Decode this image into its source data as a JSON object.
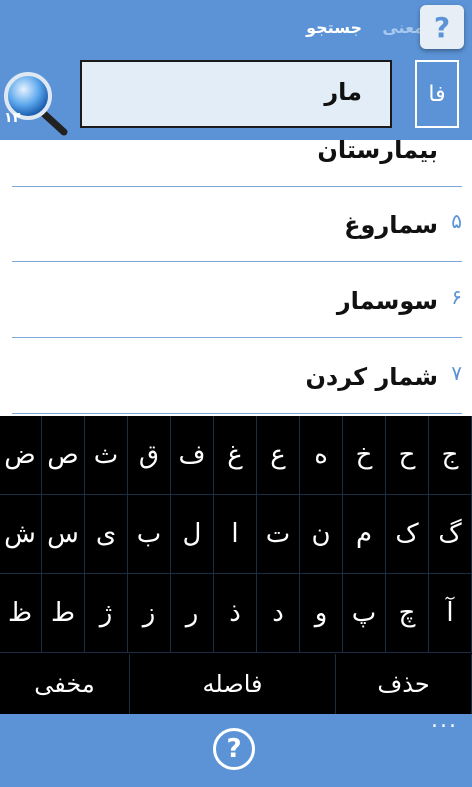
{
  "header": {
    "tab_search": "جستجو",
    "tab_meaning": "معنی",
    "help_icon": "?",
    "result_count": "۱۴"
  },
  "search": {
    "value": "مار",
    "lang_label": "فا"
  },
  "results": [
    {
      "num": "",
      "word": "بیمارستان"
    },
    {
      "num": "۵",
      "word": "سماروغ"
    },
    {
      "num": "۶",
      "word": "سوسمار"
    },
    {
      "num": "۷",
      "word": "شمار کردن"
    }
  ],
  "keyboard": {
    "rows": [
      [
        "ج",
        "ح",
        "خ",
        "ه",
        "ع",
        "غ",
        "ف",
        "ق",
        "ث",
        "ص",
        "ض"
      ],
      [
        "گ",
        "ک",
        "م",
        "ن",
        "ت",
        "ا",
        "ل",
        "ب",
        "ی",
        "س",
        "ش"
      ],
      [
        "آ",
        "چ",
        "پ",
        "و",
        "د",
        "ذ",
        "ر",
        "ز",
        "ژ",
        "ط",
        "ظ"
      ]
    ],
    "delete_label": "حذف",
    "space_label": "فاصله",
    "hide_label": "مخفی"
  },
  "footer": {
    "help_icon": "?",
    "more_icon": "..."
  }
}
